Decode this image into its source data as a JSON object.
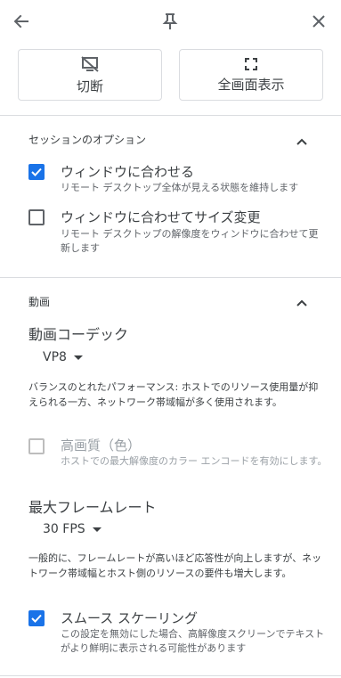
{
  "header": {
    "back_icon": "arrow-left-icon",
    "pin_icon": "pin-icon",
    "close_icon": "close-icon"
  },
  "actions": {
    "disconnect_label": "切断",
    "disconnect_icon": "screen-off-icon",
    "fullscreen_label": "全画面表示",
    "fullscreen_icon": "fullscreen-icon"
  },
  "session_options": {
    "title": "セッションのオプション",
    "expanded": true,
    "fit_window": {
      "label": "ウィンドウに合わせる",
      "description": "リモート デスクトップ全体が見える状態を維持します",
      "checked": true
    },
    "resize_to_fit": {
      "label": "ウィンドウに合わせてサイズ変更",
      "description": "リモート デスクトップの解像度をウィンドウに合わせて更新します",
      "checked": false
    }
  },
  "video": {
    "title": "動画",
    "expanded": true,
    "codec_label": "動画コーデック",
    "codec_value": "VP8",
    "codec_description": "バランスのとれたパフォーマンス: ホストでのリソース使用量が抑えられる一方、ネットワーク帯域幅が多く使用されます。",
    "high_quality": {
      "label": "高画質（色）",
      "description": "ホストでの最大解像度のカラー エンコードを有効にします。",
      "checked": false,
      "disabled": true
    },
    "framerate_label": "最大フレームレート",
    "framerate_value": "30 FPS",
    "framerate_description": "一般的に、フレームレートが高いほど応答性が向上しますが、ネットワーク帯域幅とホスト側のリソースの要件も増大します。",
    "smooth_scaling": {
      "label": "スムース スケーリング",
      "description": "この設定を無効にした場合、高解像度スクリーンでテキストがより鮮明に表示される可能性があります",
      "checked": true
    }
  },
  "colors": {
    "accent": "#1a73e8",
    "divider": "#dadce0",
    "text": "#3c4043",
    "secondary_text": "#5f6368",
    "disabled_text": "#9aa0a6"
  }
}
